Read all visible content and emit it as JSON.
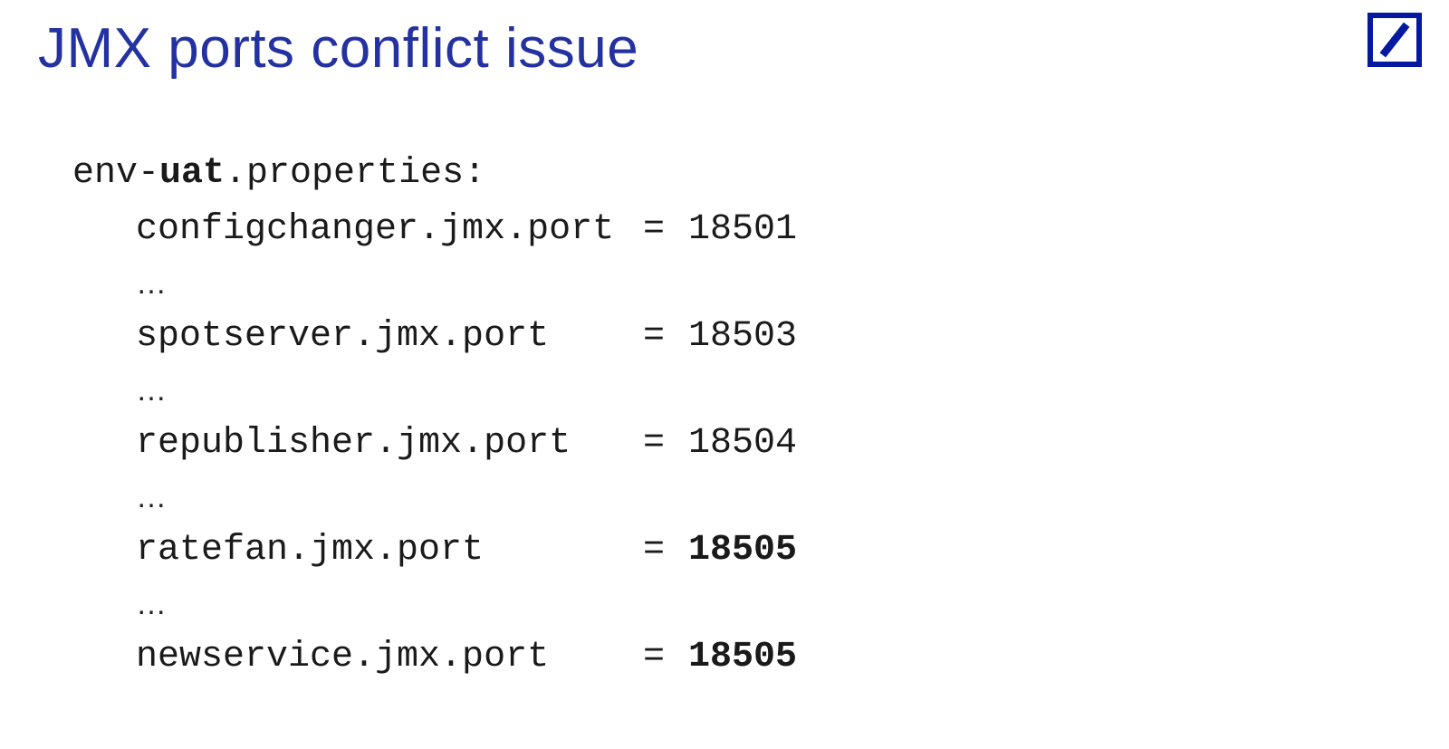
{
  "title": "JMX ports conflict issue",
  "file": {
    "prefix": "env-",
    "env": "uat",
    "suffix": ".properties:"
  },
  "ellipsis": "…",
  "equals": "=",
  "properties": [
    {
      "key": "configchanger.jmx.port",
      "value": "18501",
      "bold": false
    },
    {
      "key": "spotserver.jmx.port",
      "value": "18503",
      "bold": false
    },
    {
      "key": "republisher.jmx.port",
      "value": "18504",
      "bold": false
    },
    {
      "key": "ratefan.jmx.port",
      "value": "18505",
      "bold": true
    },
    {
      "key": "newservice.jmx.port",
      "value": "18505",
      "bold": true
    }
  ],
  "logo": {
    "color": "#0419a0"
  }
}
